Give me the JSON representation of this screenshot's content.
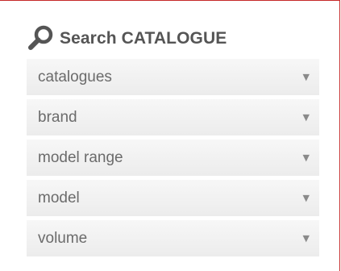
{
  "panel": {
    "title": "Search CATALOGUE",
    "title_icon": "search-icon",
    "accent_color": "#c62828"
  },
  "filters": [
    {
      "label": "catalogues",
      "icon": "chevron-down-icon"
    },
    {
      "label": "brand",
      "icon": "chevron-down-icon"
    },
    {
      "label": "model range",
      "icon": "chevron-down-icon"
    },
    {
      "label": "model",
      "icon": "chevron-down-icon"
    },
    {
      "label": "volume",
      "icon": "chevron-down-icon"
    }
  ],
  "arrow_glyph": "▼"
}
